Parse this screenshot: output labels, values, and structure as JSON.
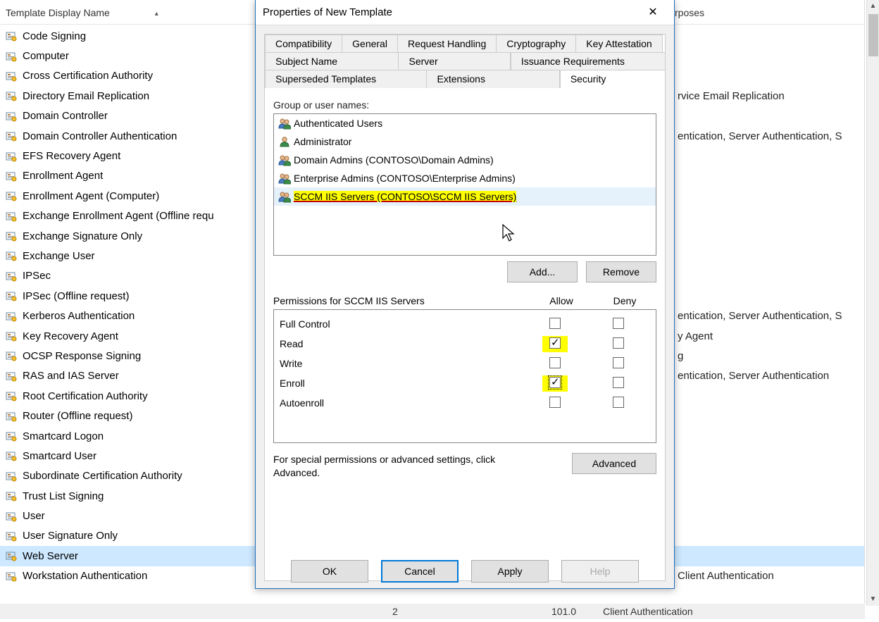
{
  "background": {
    "header_name": "Template Display Name",
    "header_purposes": "rposes",
    "items": [
      {
        "name": "Code Signing",
        "purpose": ""
      },
      {
        "name": "Computer",
        "purpose": ""
      },
      {
        "name": "Cross Certification Authority",
        "purpose": ""
      },
      {
        "name": "Directory Email Replication",
        "purpose": "rvice Email Replication"
      },
      {
        "name": "Domain Controller",
        "purpose": ""
      },
      {
        "name": "Domain Controller Authentication",
        "purpose": "entication, Server Authentication, S"
      },
      {
        "name": "EFS Recovery Agent",
        "purpose": ""
      },
      {
        "name": "Enrollment Agent",
        "purpose": ""
      },
      {
        "name": "Enrollment Agent (Computer)",
        "purpose": ""
      },
      {
        "name": "Exchange Enrollment Agent (Offline requ",
        "purpose": ""
      },
      {
        "name": "Exchange Signature Only",
        "purpose": ""
      },
      {
        "name": "Exchange User",
        "purpose": ""
      },
      {
        "name": "IPSec",
        "purpose": ""
      },
      {
        "name": "IPSec (Offline request)",
        "purpose": ""
      },
      {
        "name": "Kerberos Authentication",
        "purpose": "entication, Server Authentication, S"
      },
      {
        "name": "Key Recovery Agent",
        "purpose": "y Agent"
      },
      {
        "name": "OCSP Response Signing",
        "purpose": "g"
      },
      {
        "name": "RAS and IAS Server",
        "purpose": "entication, Server Authentication"
      },
      {
        "name": "Root Certification Authority",
        "purpose": ""
      },
      {
        "name": "Router (Offline request)",
        "purpose": ""
      },
      {
        "name": "Smartcard Logon",
        "purpose": ""
      },
      {
        "name": "Smartcard User",
        "purpose": ""
      },
      {
        "name": "Subordinate Certification Authority",
        "purpose": ""
      },
      {
        "name": "Trust List Signing",
        "purpose": ""
      },
      {
        "name": "User",
        "purpose": ""
      },
      {
        "name": "User Signature Only",
        "purpose": ""
      },
      {
        "name": "Web Server",
        "purpose": "",
        "selected": true
      },
      {
        "name": "Workstation Authentication",
        "purpose": "Client Authentication"
      }
    ]
  },
  "status": {
    "col2": "2",
    "col3": "101.0",
    "col4": "Client Authentication"
  },
  "dialog": {
    "title": "Properties of New Template",
    "tabs_row1": [
      "Compatibility",
      "General",
      "Request Handling",
      "Cryptography",
      "Key Attestation"
    ],
    "tabs_row2": [
      "Subject Name",
      "Server",
      "Issuance Requirements"
    ],
    "tabs_row3": [
      "Superseded Templates",
      "Extensions",
      "Security"
    ],
    "active_tab": "Security",
    "group_label": "Group or user names:",
    "groups": [
      {
        "name": "Authenticated Users",
        "type": "group"
      },
      {
        "name": "Administrator",
        "type": "user"
      },
      {
        "name": "Domain Admins (CONTOSO\\Domain Admins)",
        "type": "group"
      },
      {
        "name": "Enterprise Admins (CONTOSO\\Enterprise Admins)",
        "type": "group"
      },
      {
        "name": "SCCM IIS Servers (CONTOSO\\SCCM IIS Servers)",
        "type": "group",
        "highlighted": true,
        "selected": true
      }
    ],
    "add_label": "Add...",
    "remove_label": "Remove",
    "perm_label": "Permissions for SCCM IIS Servers",
    "allow_label": "Allow",
    "deny_label": "Deny",
    "permissions": [
      {
        "name": "Full Control",
        "allow": false,
        "deny": false
      },
      {
        "name": "Read",
        "allow": true,
        "deny": false,
        "hl_allow": true
      },
      {
        "name": "Write",
        "allow": false,
        "deny": false
      },
      {
        "name": "Enroll",
        "allow": true,
        "deny": false,
        "hl_allow": true,
        "focused": true
      },
      {
        "name": "Autoenroll",
        "allow": false,
        "deny": false
      }
    ],
    "advanced_text": "For special permissions or advanced settings, click Advanced.",
    "advanced_btn": "Advanced",
    "ok": "OK",
    "cancel": "Cancel",
    "apply": "Apply",
    "help": "Help"
  }
}
